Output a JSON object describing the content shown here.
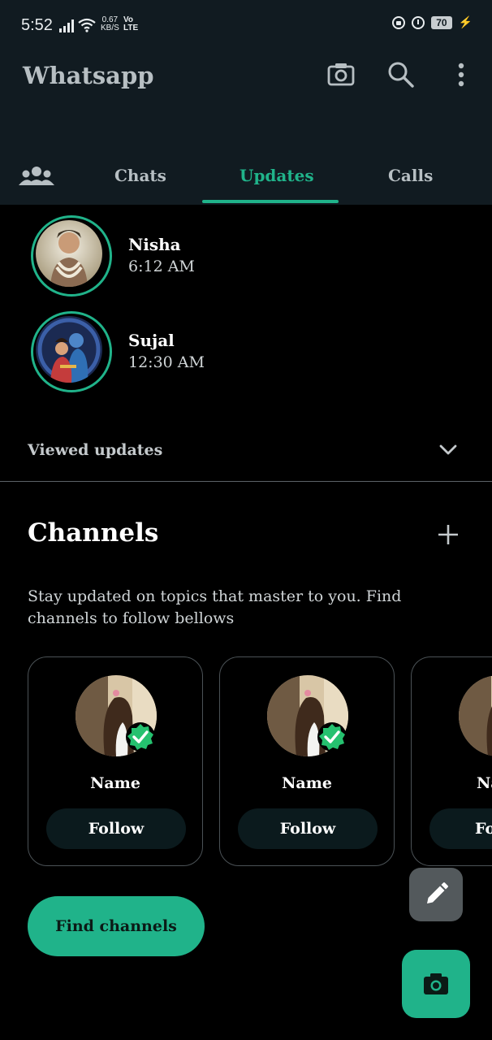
{
  "status_bar": {
    "time": "5:52",
    "net_speed_value": "0.67",
    "net_speed_unit": "KB/S",
    "volte_top": "Vo",
    "volte_bottom": "LTE",
    "battery": "70"
  },
  "app_bar": {
    "title": "Whatsapp",
    "icons": [
      "camera-icon",
      "search-icon",
      "more-vert-icon"
    ]
  },
  "tabs": {
    "community_icon": "community-icon",
    "items": [
      {
        "label": "Chats",
        "active": false
      },
      {
        "label": "Updates",
        "active": true
      },
      {
        "label": "Calls",
        "active": false
      }
    ]
  },
  "status_updates": [
    {
      "name": "Nisha",
      "time": "6:12 AM"
    },
    {
      "name": "Sujal",
      "time": "12:30 AM"
    }
  ],
  "viewed_updates_label": "Viewed updates",
  "channels": {
    "title": "Channels",
    "description": "Stay updated on topics that master to you. Find channels to follow bellows",
    "cards": [
      {
        "name": "Name",
        "follow_label": "Follow"
      },
      {
        "name": "Name",
        "follow_label": "Follow"
      },
      {
        "name": "Name",
        "follow_label": "Follow"
      }
    ],
    "find_button": "Find channels"
  },
  "colors": {
    "accent": "#20b38a",
    "appbar_bg": "#111b21",
    "background": "#000000",
    "follow_bg": "#0b1a1d",
    "pencil_fab_bg": "#53595c"
  }
}
